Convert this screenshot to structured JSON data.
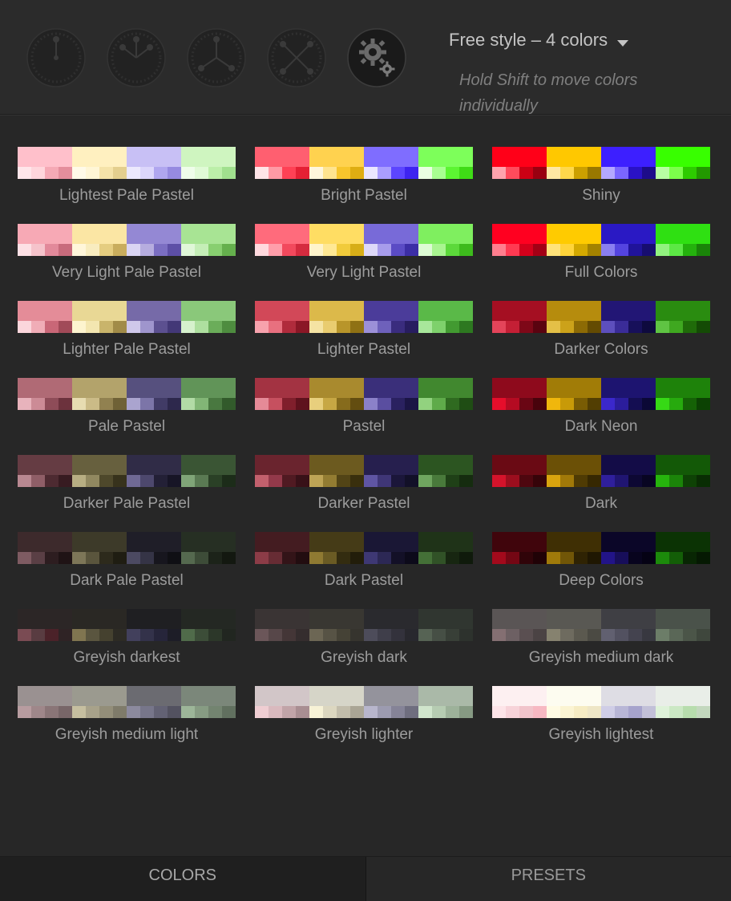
{
  "toolbar": {
    "wheels": [
      {
        "icon": "wheel-1-color-icon",
        "active": false
      },
      {
        "icon": "wheel-2-colors-icon",
        "active": false
      },
      {
        "icon": "wheel-3-colors-icon",
        "active": false
      },
      {
        "icon": "wheel-4-colors-icon",
        "active": false
      },
      {
        "icon": "gear-settings-icon",
        "active": true
      }
    ],
    "mode_label": "Free style – 4 colors",
    "hint": "Hold Shift to move colors individually"
  },
  "presets": [
    {
      "name": "Lightest Pale Pastel",
      "colors": [
        {
          "main": "#ffc0cb",
          "shades": [
            "#ffe6ea",
            "#ffd6dc",
            "#f5a9b5",
            "#e48e9c"
          ]
        },
        {
          "main": "#fff0c0",
          "shades": [
            "#fffae8",
            "#fff6d6",
            "#f5e3a9",
            "#e4cf8e"
          ]
        },
        {
          "main": "#c8c0f5",
          "shades": [
            "#ece9fd",
            "#dcd6fb",
            "#b0a6ef",
            "#968ae0"
          ]
        },
        {
          "main": "#cff5c0",
          "shades": [
            "#effdea",
            "#e0fad6",
            "#bcefa9",
            "#a1e08e"
          ]
        }
      ]
    },
    {
      "name": "Bright Pastel",
      "colors": [
        {
          "main": "#ff5f70",
          "shades": [
            "#ffe4e7",
            "#ff9aa5",
            "#ff4155",
            "#e52034"
          ]
        },
        {
          "main": "#ffd24f",
          "shades": [
            "#fff6dc",
            "#ffe48f",
            "#f7c52c",
            "#dfad12"
          ]
        },
        {
          "main": "#7f6dff",
          "shades": [
            "#eae6ff",
            "#aa9eff",
            "#5c45ff",
            "#3e24f0"
          ]
        },
        {
          "main": "#7dff5a",
          "shades": [
            "#eaffe2",
            "#a8ff91",
            "#5cf532",
            "#3fdc16"
          ]
        }
      ]
    },
    {
      "name": "Shiny",
      "colors": [
        {
          "main": "#ff0018",
          "shades": [
            "#ffa3ad",
            "#ff4b5c",
            "#cc0014",
            "#990010"
          ]
        },
        {
          "main": "#ffc800",
          "shades": [
            "#ffe8a3",
            "#ffd84b",
            "#cca000",
            "#997800"
          ]
        },
        {
          "main": "#3d1fff",
          "shades": [
            "#b4a8ff",
            "#7a66ff",
            "#2a12c6",
            "#1d0c8a"
          ]
        },
        {
          "main": "#38ff00",
          "shades": [
            "#b8ffa3",
            "#7cff4b",
            "#2dcc00",
            "#229900"
          ]
        }
      ]
    },
    {
      "name": "Very Light Pale Pastel",
      "colors": [
        {
          "main": "#f7a9b5",
          "shades": [
            "#fde0e5",
            "#f5c3cb",
            "#e2899a",
            "#c86b7c"
          ]
        },
        {
          "main": "#fbe6a4",
          "shades": [
            "#fff6da",
            "#f8ecbf",
            "#e5cd80",
            "#c9ad5d"
          ]
        },
        {
          "main": "#9488d4",
          "shades": [
            "#dad5f3",
            "#b6addf",
            "#7b6ec2",
            "#5d4fa6"
          ]
        },
        {
          "main": "#a8e494",
          "shades": [
            "#e0f7d8",
            "#c5eeb7",
            "#88cf70",
            "#65b04d"
          ]
        }
      ]
    },
    {
      "name": "Very Light Pastel",
      "colors": [
        {
          "main": "#ff6b7c",
          "shades": [
            "#ffd9de",
            "#ff9eaa",
            "#f2495d",
            "#d52b3f"
          ]
        },
        {
          "main": "#ffdd63",
          "shades": [
            "#fff4cc",
            "#ffe894",
            "#f1cb3b",
            "#d7ae18"
          ]
        },
        {
          "main": "#786ad8",
          "shades": [
            "#ddd8f8",
            "#a79ceb",
            "#5a4bc5",
            "#3c2ea6"
          ]
        },
        {
          "main": "#7fef5f",
          "shades": [
            "#ddfbd4",
            "#a9f590",
            "#5cd93a",
            "#3dbb1c"
          ]
        }
      ]
    },
    {
      "name": "Full Colors",
      "colors": [
        {
          "main": "#ff0020",
          "shades": [
            "#ff7e8e",
            "#ff3a52",
            "#d4001b",
            "#a30015"
          ]
        },
        {
          "main": "#ffcb00",
          "shades": [
            "#ffe37a",
            "#ffd43a",
            "#d4a900",
            "#a38200"
          ]
        },
        {
          "main": "#2a19c4",
          "shades": [
            "#8a7ff0",
            "#5444e0",
            "#20139a",
            "#170d70"
          ]
        },
        {
          "main": "#2fe012",
          "shades": [
            "#92f27f",
            "#5ce845",
            "#24b20d",
            "#1a8409"
          ]
        }
      ]
    },
    {
      "name": "Lighter Pale Pastel",
      "colors": [
        {
          "main": "#e48c98",
          "shades": [
            "#fbd6dc",
            "#f0adb7",
            "#c96777",
            "#a14a58"
          ]
        },
        {
          "main": "#e9d895",
          "shades": [
            "#fdf4cf",
            "#f3e6b0",
            "#c9b46b",
            "#a18b48"
          ]
        },
        {
          "main": "#766aa8",
          "shades": [
            "#cfc8ea",
            "#9f95cd",
            "#5c5090",
            "#433877"
          ]
        },
        {
          "main": "#8ac87a",
          "shades": [
            "#d6f1cd",
            "#aedf9f",
            "#6bad5a",
            "#4e8c3f"
          ]
        }
      ]
    },
    {
      "name": "Lighter Pastel",
      "colors": [
        {
          "main": "#d24858",
          "shades": [
            "#f7a2ad",
            "#e8707f",
            "#b02b3c",
            "#8a1726"
          ]
        },
        {
          "main": "#dcb94a",
          "shades": [
            "#f5e3a3",
            "#e9cc70",
            "#b8952a",
            "#8f7114"
          ]
        },
        {
          "main": "#4b3c9a",
          "shades": [
            "#9c90d8",
            "#6e61bb",
            "#3a2c7e",
            "#281d60"
          ]
        },
        {
          "main": "#5ab948",
          "shades": [
            "#a8e79b",
            "#7ed16c",
            "#429a31",
            "#2d7820"
          ]
        }
      ]
    },
    {
      "name": "Darker Colors",
      "colors": [
        {
          "main": "#a50f22",
          "shades": [
            "#e4445a",
            "#c41f35",
            "#7e0818",
            "#5a0310"
          ]
        },
        {
          "main": "#b68c0d",
          "shades": [
            "#e4c047",
            "#cca21a",
            "#8c6a05",
            "#644b02"
          ]
        },
        {
          "main": "#221675",
          "shades": [
            "#5d4fbd",
            "#3a2c98",
            "#17105a",
            "#0e0a3e"
          ]
        },
        {
          "main": "#2a8c10",
          "shades": [
            "#5fc443",
            "#3fa820",
            "#1f6b09",
            "#144b05"
          ]
        }
      ]
    },
    {
      "name": "Pale Pastel",
      "colors": [
        {
          "main": "#b06a75",
          "shades": [
            "#e8b3bc",
            "#cc8b96",
            "#8e4c58",
            "#6c323d"
          ]
        },
        {
          "main": "#b3a36b",
          "shades": [
            "#e7dcb1",
            "#cbbb87",
            "#918150",
            "#6f6136"
          ]
        },
        {
          "main": "#56507e",
          "shades": [
            "#aaa4cf",
            "#7c75a8",
            "#413b66",
            "#2d284c"
          ]
        },
        {
          "main": "#619458",
          "shades": [
            "#b2dba6",
            "#82b676",
            "#497840",
            "#325a2b"
          ]
        }
      ]
    },
    {
      "name": "Pastel",
      "colors": [
        {
          "main": "#a33342",
          "shades": [
            "#e58a97",
            "#c6505f",
            "#801f2c",
            "#5e121d"
          ]
        },
        {
          "main": "#a98a2e",
          "shades": [
            "#e8cf7d",
            "#c7a744",
            "#866b1c",
            "#634d10"
          ]
        },
        {
          "main": "#3a2f7a",
          "shades": [
            "#8b81c9",
            "#5a4ea0",
            "#2a2160",
            "#1b1545"
          ]
        },
        {
          "main": "#41882f",
          "shades": [
            "#92d27f",
            "#5fab4a",
            "#2f6a20",
            "#1f4d14"
          ]
        }
      ]
    },
    {
      "name": "Dark Neon",
      "colors": [
        {
          "main": "#8e0a1c",
          "shades": [
            "#e60e2b",
            "#b50b22",
            "#6a0614",
            "#48030c"
          ]
        },
        {
          "main": "#a17c07",
          "shades": [
            "#f0b70c",
            "#c89a08",
            "#795c04",
            "#523e02"
          ]
        },
        {
          "main": "#1d1470",
          "shades": [
            "#3b28cc",
            "#2b1d9c",
            "#140e52",
            "#0b0836"
          ]
        },
        {
          "main": "#1e820a",
          "shades": [
            "#36d915",
            "#27aa0e",
            "#156206",
            "#0c4203"
          ]
        }
      ]
    },
    {
      "name": "Darker Pale Pastel",
      "colors": [
        {
          "main": "#653c43",
          "shades": [
            "#b88891",
            "#8f5e67",
            "#4d2a31",
            "#371b21"
          ]
        },
        {
          "main": "#67603e",
          "shades": [
            "#b8ae83",
            "#918860",
            "#4e482b",
            "#37321c"
          ]
        },
        {
          "main": "#302c47",
          "shades": [
            "#6f6994",
            "#4d486d",
            "#232036",
            "#171526"
          ]
        },
        {
          "main": "#3a5534",
          "shades": [
            "#80a578",
            "#5a7a53",
            "#2a4026",
            "#1c2c19"
          ]
        }
      ]
    },
    {
      "name": "Darker Pastel",
      "colors": [
        {
          "main": "#6a242e",
          "shades": [
            "#c2606d",
            "#93394a",
            "#501a22",
            "#381118"
          ]
        },
        {
          "main": "#6c5a1f",
          "shades": [
            "#bea455",
            "#937c32",
            "#524416",
            "#392f0d"
          ]
        },
        {
          "main": "#261f4e",
          "shades": [
            "#5f55a3",
            "#3f3677",
            "#1b163a",
            "#121028"
          ]
        },
        {
          "main": "#2c5521",
          "shades": [
            "#6fa55f",
            "#497a3b",
            "#1f4017",
            "#152c0f"
          ]
        }
      ]
    },
    {
      "name": "Dark",
      "colors": [
        {
          "main": "#6a0a14",
          "shades": [
            "#d4132b",
            "#9c0e1e",
            "#4e070f",
            "#360409"
          ]
        },
        {
          "main": "#6b5006",
          "shades": [
            "#d9a40e",
            "#a17909",
            "#4f3b04",
            "#362802"
          ]
        },
        {
          "main": "#130c47",
          "shades": [
            "#2f1f9c",
            "#201572",
            "#0d0833",
            "#080522"
          ]
        },
        {
          "main": "#135907",
          "shades": [
            "#26b40d",
            "#1b8409",
            "#0e4205",
            "#092d03"
          ]
        }
      ]
    },
    {
      "name": "Dark Pale Pastel",
      "colors": [
        {
          "main": "#3d2a2c",
          "shades": [
            "#7e5b62",
            "#5a3f45",
            "#2d1d20",
            "#1f1315"
          ]
        },
        {
          "main": "#3d3a29",
          "shades": [
            "#7d7658",
            "#5a553d",
            "#2d2a1c",
            "#1f1d12"
          ]
        },
        {
          "main": "#1f1e28",
          "shades": [
            "#4c4a62",
            "#353446",
            "#17161e",
            "#0f0f14"
          ]
        },
        {
          "main": "#262f23",
          "shades": [
            "#55694f",
            "#3d4c38",
            "#1c2319",
            "#131810"
          ]
        }
      ]
    },
    {
      "name": "Dark Pastel",
      "colors": [
        {
          "main": "#441c21",
          "shades": [
            "#8c3c47",
            "#672c34",
            "#331418",
            "#220d10"
          ]
        },
        {
          "main": "#453b17",
          "shades": [
            "#8f7a32",
            "#6a5b24",
            "#332c10",
            "#221d0a"
          ]
        },
        {
          "main": "#1a1735",
          "shades": [
            "#3e3874",
            "#2c2855",
            "#131027",
            "#0c0a1a"
          ]
        },
        {
          "main": "#1f3318",
          "shades": [
            "#447037",
            "#315227",
            "#172611",
            "#0f1a0b"
          ]
        }
      ]
    },
    {
      "name": "Deep Colors",
      "colors": [
        {
          "main": "#40050c",
          "shades": [
            "#a30a1c",
            "#740714",
            "#300409",
            "#200206"
          ]
        },
        {
          "main": "#3f2f04",
          "shades": [
            "#a07a0a",
            "#715607",
            "#2f2303",
            "#1f1702"
          ]
        },
        {
          "main": "#0b0628",
          "shades": [
            "#221488",
            "#170e5a",
            "#08041e",
            "#050214"
          ]
        },
        {
          "main": "#0b3304",
          "shades": [
            "#1c8a0b",
            "#135e07",
            "#082603",
            "#051902"
          ]
        }
      ]
    },
    {
      "name": "Greyish darkest",
      "colors": [
        {
          "main": "#2c2626",
          "shades": [
            "#7a4b53",
            "#593c41",
            "#4b2229",
            "#2f2325"
          ]
        },
        {
          "main": "#2a2824",
          "shades": [
            "#807550",
            "#5a553f",
            "#45412f",
            "#2d2b24"
          ]
        },
        {
          "main": "#1f1f22",
          "shades": [
            "#42405c",
            "#33324a",
            "#26253a",
            "#1d1d27"
          ]
        },
        {
          "main": "#242823",
          "shades": [
            "#506b4a",
            "#3c4d38",
            "#2c3729",
            "#212620"
          ]
        }
      ]
    },
    {
      "name": "Greyish dark",
      "colors": [
        {
          "main": "#3a3434",
          "shades": [
            "#6b5659",
            "#574749",
            "#443637",
            "#352d2e"
          ]
        },
        {
          "main": "#393732",
          "shades": [
            "#6c6654",
            "#575345",
            "#454236",
            "#36342e"
          ]
        },
        {
          "main": "#2a2a2e",
          "shades": [
            "#4d4c5a",
            "#3f3e4a",
            "#33323c",
            "#28282e"
          ]
        },
        {
          "main": "#303630",
          "shades": [
            "#566354",
            "#464f45",
            "#383f37",
            "#2d322d"
          ]
        }
      ]
    },
    {
      "name": "Greyish medium dark",
      "colors": [
        {
          "main": "#5a5555",
          "shades": [
            "#846f72",
            "#6d6063",
            "#5a4f51",
            "#4b4344"
          ]
        },
        {
          "main": "#595853",
          "shades": [
            "#86826f",
            "#6e6b5f",
            "#5b594f",
            "#4b4a43"
          ]
        },
        {
          "main": "#3f3f44",
          "shades": [
            "#616070",
            "#525160",
            "#44434f",
            "#383840"
          ]
        },
        {
          "main": "#4a524a",
          "shades": [
            "#6c7d68",
            "#5a6757",
            "#4b5548",
            "#3f473d"
          ]
        }
      ]
    },
    {
      "name": "Greyish medium light",
      "colors": [
        {
          "main": "#9a9191",
          "shades": [
            "#b89ca0",
            "#9f878a",
            "#8a7577",
            "#786668"
          ]
        },
        {
          "main": "#9b9a8f",
          "shades": [
            "#c6bfa0",
            "#a8a28a",
            "#938e79",
            "#7f7b6a"
          ]
        },
        {
          "main": "#6b6b71",
          "shades": [
            "#8c8a9e",
            "#77768a",
            "#636274",
            "#535260"
          ]
        },
        {
          "main": "#7b877a",
          "shades": [
            "#9db699",
            "#879c83",
            "#738470",
            "#61705f"
          ]
        }
      ]
    },
    {
      "name": "Greyish lighter",
      "colors": [
        {
          "main": "#d2c6c8",
          "shades": [
            "#efcdd2",
            "#d9b9be",
            "#c1a4a8",
            "#a98e92"
          ]
        },
        {
          "main": "#d6d5c8",
          "shades": [
            "#f7f2d6",
            "#dcd7c0",
            "#c2bdab",
            "#aaa595"
          ]
        },
        {
          "main": "#94939c",
          "shades": [
            "#b8b6cc",
            "#9c9bb0",
            "#858397",
            "#6f6e7f"
          ]
        },
        {
          "main": "#aab9a8",
          "shades": [
            "#d0e5cc",
            "#b6ccb2",
            "#9db29a",
            "#869a83"
          ]
        }
      ]
    },
    {
      "name": "Greyish lightest",
      "colors": [
        {
          "main": "#fdf0f1",
          "shades": [
            "#fde4e8",
            "#f7d3d9",
            "#f1c4cb",
            "#f7b8c2"
          ]
        },
        {
          "main": "#fdfcf0",
          "shades": [
            "#fffbe4",
            "#fbf4d2",
            "#f6ecc3",
            "#eee6c6"
          ]
        },
        {
          "main": "#dedde4",
          "shades": [
            "#cfcde6",
            "#b8b6d6",
            "#a6a3cc",
            "#c2c0d8"
          ]
        },
        {
          "main": "#e9eee8",
          "shades": [
            "#def2d9",
            "#cbe8c4",
            "#b7ddad",
            "#c3d8be"
          ]
        }
      ]
    }
  ],
  "tabs": [
    {
      "label": "COLORS",
      "active": true
    },
    {
      "label": "PRESETS",
      "active": false
    }
  ]
}
